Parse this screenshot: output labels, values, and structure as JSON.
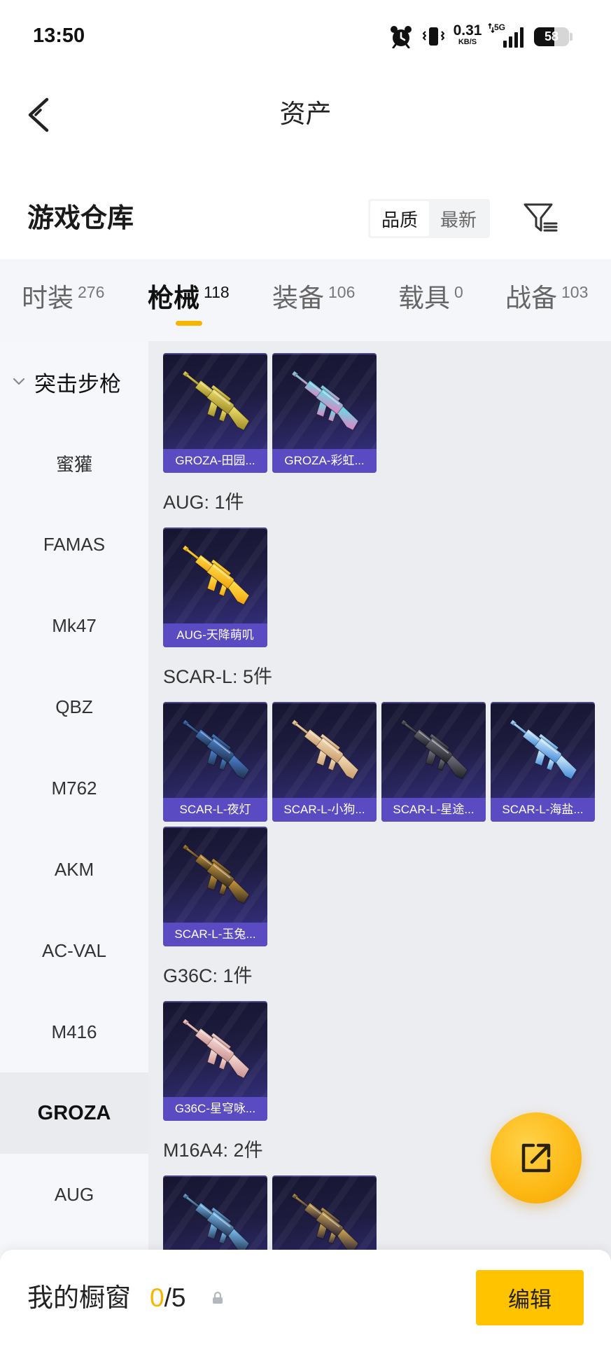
{
  "status_bar": {
    "time": "13:50",
    "net_speed": "0.31",
    "net_speed_unit": "KB/S",
    "network_type": "5G",
    "battery_percent": "58",
    "battery_level": 0.58,
    "icons": [
      "alarm-icon",
      "vibrate-icon",
      "signal-icon",
      "battery-icon"
    ]
  },
  "header": {
    "title": "资产",
    "back_icon": "back-arrow-icon"
  },
  "warehouse": {
    "title": "游戏仓库",
    "sort_options": [
      {
        "label": "品质",
        "selected": true
      },
      {
        "label": "最新",
        "selected": false
      }
    ],
    "filter_icon": "filter-icon"
  },
  "tabs": [
    {
      "label": "时装",
      "count": "276",
      "active": false
    },
    {
      "label": "枪械",
      "count": "118",
      "active": true
    },
    {
      "label": "装备",
      "count": "106",
      "active": false
    },
    {
      "label": "载具",
      "count": "0",
      "active": false
    },
    {
      "label": "战备",
      "count": "103",
      "active": false
    }
  ],
  "sidebar": {
    "category": "突击步枪",
    "category_icon": "chevron-down-icon",
    "items": [
      {
        "label": "蜜獾"
      },
      {
        "label": "FAMAS"
      },
      {
        "label": "Mk47"
      },
      {
        "label": "QBZ"
      },
      {
        "label": "M762"
      },
      {
        "label": "AKM"
      },
      {
        "label": "AC-VAL"
      },
      {
        "label": "M416"
      },
      {
        "label": "GROZA",
        "selected": true
      },
      {
        "label": "AUG"
      }
    ]
  },
  "gallery": {
    "groups": [
      {
        "items": [
          {
            "name": "GROZA-田园...",
            "colors": [
              "#f0e16c",
              "#9a8722"
            ]
          },
          {
            "name": "GROZA-彩虹...",
            "colors": [
              "#63e0e6",
              "#e57cc2"
            ]
          }
        ]
      },
      {
        "heading": "AUG: 1件",
        "items": [
          {
            "name": "AUG-天降萌叽",
            "colors": [
              "#ffe24e",
              "#f1a00a"
            ]
          }
        ]
      },
      {
        "heading": "SCAR-L: 5件",
        "items": [
          {
            "name": "SCAR-L-夜灯",
            "colors": [
              "#4c86d8",
              "#1f2c44"
            ]
          },
          {
            "name": "SCAR-L-小狗...",
            "colors": [
              "#f6dfba",
              "#c79868"
            ]
          },
          {
            "name": "SCAR-L-星途...",
            "colors": [
              "#74747f",
              "#1b1b22"
            ]
          },
          {
            "name": "SCAR-L-海盐...",
            "colors": [
              "#d3f0ff",
              "#3f86d8"
            ]
          },
          {
            "name": "SCAR-L-玉兔...",
            "colors": [
              "#cc9a40",
              "#2e261c"
            ]
          }
        ]
      },
      {
        "heading": "G36C: 1件",
        "items": [
          {
            "name": "G36C-星穹咏...",
            "colors": [
              "#f8dcd6",
              "#c98f8f"
            ]
          }
        ]
      },
      {
        "heading": "M16A4: 2件",
        "items": [
          {
            "colors": [
              "#7cc2f5",
              "#22304f"
            ]
          },
          {
            "colors": [
              "#d2ab52",
              "#231b36"
            ]
          }
        ]
      }
    ]
  },
  "fab": {
    "icon": "open-external-icon"
  },
  "bottom_bar": {
    "title": "我的橱窗",
    "used": "0",
    "limit": "/5",
    "lock_icon": "lock-icon",
    "edit_label": "编辑"
  },
  "colors": {
    "accent": "#f7b500",
    "card_label": "#5b4bc3",
    "sidebar_selected": "#e9ebef",
    "fab": "#fdb813",
    "edit_button": "#ffc300"
  }
}
